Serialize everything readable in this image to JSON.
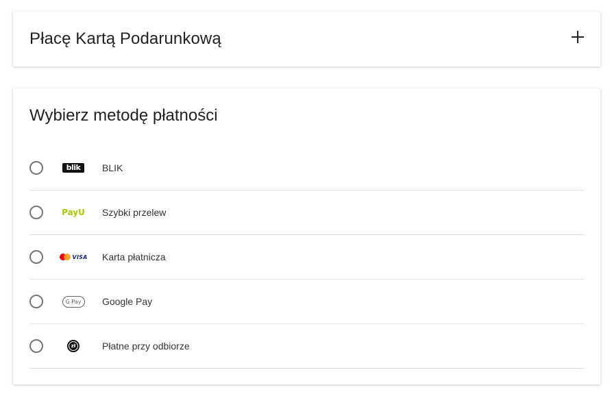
{
  "gift_card": {
    "title": "Płacę Kartą Podarunkową",
    "expand_icon": "plus-icon"
  },
  "payment_methods": {
    "title": "Wybierz metodę płatności",
    "items": [
      {
        "label": "BLIK",
        "logo": "blik-logo",
        "logo_text": "blik",
        "selected": false
      },
      {
        "label": "Szybki przelew",
        "logo": "payu-logo",
        "logo_text": "PayU",
        "selected": false
      },
      {
        "label": "Karta płatnicza",
        "logo": "mastercard-visa-logo",
        "logo_text": "VISA",
        "selected": false
      },
      {
        "label": "Google Pay",
        "logo": "google-pay-logo",
        "logo_text": "G Pay",
        "selected": false
      },
      {
        "label": "Płatne przy odbiorze",
        "logo": "cash-on-delivery-icon",
        "logo_text": "zł",
        "selected": false
      }
    ]
  },
  "colors": {
    "text": "#222222",
    "divider": "#e3e3e3",
    "radio_border": "#757575",
    "payu_green": "#a6c307",
    "visa_blue": "#1a1f71"
  }
}
